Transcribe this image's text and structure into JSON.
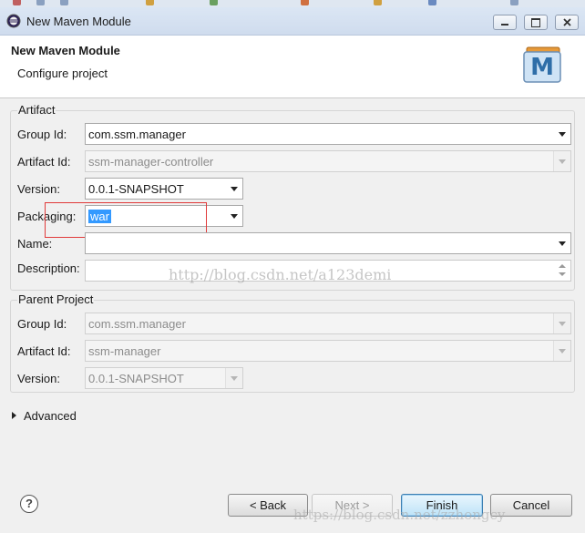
{
  "window": {
    "title": "New Maven Module"
  },
  "header": {
    "title": "New Maven Module",
    "subtitle": "Configure project"
  },
  "artifact": {
    "section_label": "Artifact",
    "group_id": {
      "label": "Group Id:",
      "value": "com.ssm.manager"
    },
    "artifact_id": {
      "label": "Artifact Id:",
      "value": "ssm-manager-controller"
    },
    "version": {
      "label": "Version:",
      "value": "0.0.1-SNAPSHOT"
    },
    "packaging": {
      "label": "Packaging:",
      "value": "war"
    },
    "name": {
      "label": "Name:",
      "value": ""
    },
    "description": {
      "label": "Description:",
      "value": ""
    }
  },
  "parent": {
    "section_label": "Parent Project",
    "group_id": {
      "label": "Group Id:",
      "value": "com.ssm.manager"
    },
    "artifact_id": {
      "label": "Artifact Id:",
      "value": "ssm-manager"
    },
    "version": {
      "label": "Version:",
      "value": "0.0.1-SNAPSHOT"
    }
  },
  "advanced_label": "Advanced",
  "buttons": {
    "help": "?",
    "back": "< Back",
    "next": "Next >",
    "finish": "Finish",
    "cancel": "Cancel"
  },
  "watermarks": {
    "center": "http://blog.csdn.net/a123demi",
    "bottom": "https://blog.csdn.net/zzhongcy"
  },
  "logo_letter": "M",
  "colors": {
    "selection": "#3399ff",
    "highlight_box": "#e03a3a",
    "default_button_border": "#3c7fb1"
  }
}
